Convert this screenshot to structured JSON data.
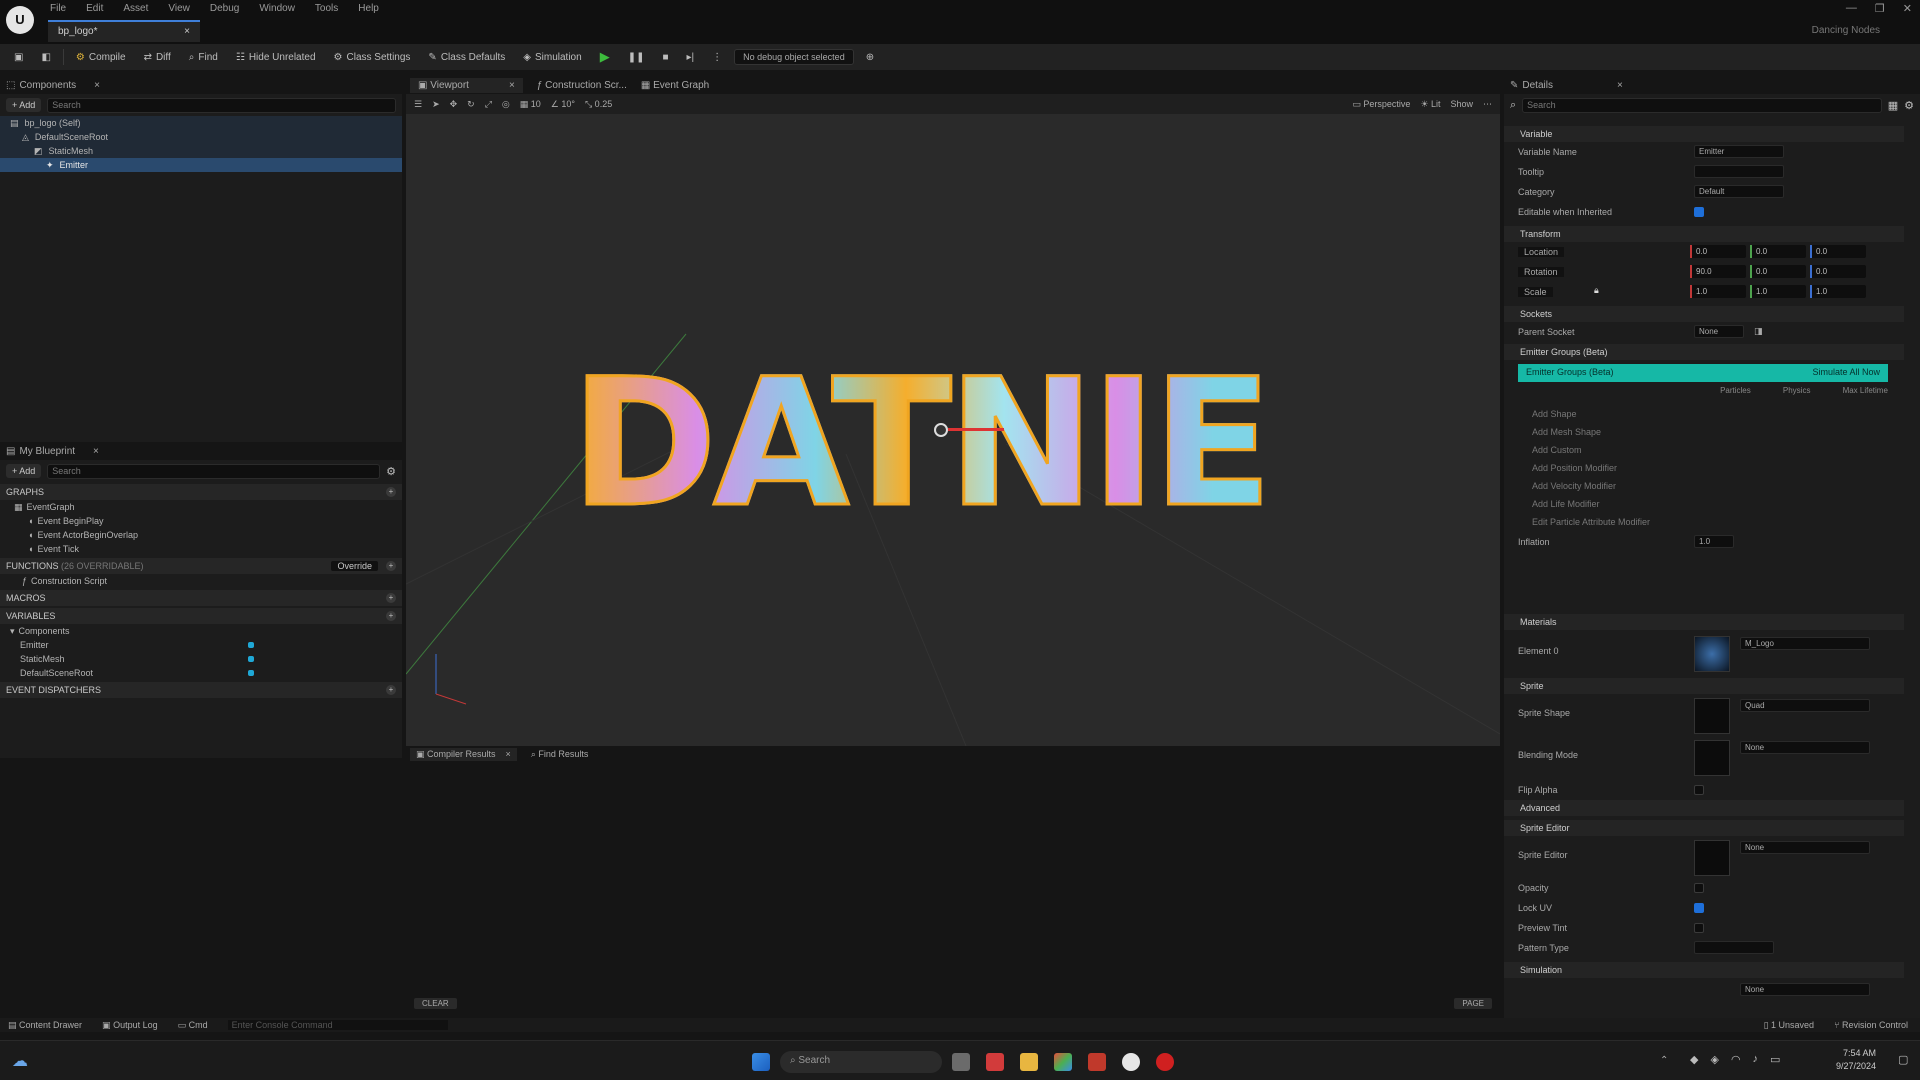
{
  "window": {
    "logo_glyph": "U",
    "menu": [
      "File",
      "Edit",
      "Asset",
      "View",
      "Debug",
      "Window",
      "Tools",
      "Help"
    ],
    "doc_tab": "bp_logo*",
    "doc_tab_close": "×",
    "project_name": "Dancing Nodes",
    "controls": [
      "—",
      "❐",
      "✕"
    ]
  },
  "toolbar": {
    "compile": "Compile",
    "diff": "Diff",
    "find": "Find",
    "hide_unrelated": "Hide Unrelated",
    "class_settings": "Class Settings",
    "class_defaults": "Class Defaults",
    "simulation": "Simulation",
    "debug_filter": "No debug object selected"
  },
  "components": {
    "tab": "Components",
    "add": "+ Add",
    "search_placeholder": "Search",
    "tree": [
      "bp_logo (Self)",
      "DefaultSceneRoot",
      "StaticMesh",
      "Emitter"
    ]
  },
  "my_blueprint": {
    "tab": "My Blueprint",
    "add": "+ Add",
    "search_placeholder": "Search",
    "graphs_label": "GRAPHS",
    "event_graph": "EventGraph",
    "events": [
      "Event BeginPlay",
      "Event ActorBeginOverlap",
      "Event Tick"
    ],
    "functions_label": "FUNCTIONS",
    "functions_hint": "(26 OVERRIDABLE)",
    "override_btn": "Override",
    "construction_script": "Construction Script",
    "macros_label": "MACROS",
    "variables_label": "VARIABLES",
    "components_label": "Components",
    "variables": [
      "Emitter",
      "StaticMesh",
      "DefaultSceneRoot"
    ],
    "dispatchers_label": "EVENT DISPATCHERS"
  },
  "viewport": {
    "tabs": [
      "Viewport",
      "Construction Scr...",
      "Event Graph"
    ],
    "perspective": "Perspective",
    "lit": "Lit",
    "show": "Show",
    "logo_text": "DATNIE"
  },
  "bottom": {
    "tabs": [
      "Compiler Results",
      "Find Results"
    ],
    "clear": "CLEAR",
    "page_btn": "PAGE"
  },
  "statusbar": {
    "content_drawer": "Content Drawer",
    "output_log": "Output Log",
    "cmd": "Cmd",
    "cmd_placeholder": "Enter Console Command",
    "unsaved": "1 Unsaved",
    "revision": "Revision Control"
  },
  "details": {
    "tab": "Details",
    "search_placeholder": "Search",
    "sections": {
      "variable": "Variable",
      "transform": "Transform",
      "sockets": "Sockets",
      "emitter_groups": "Emitter Groups (Beta)",
      "materials": "Materials",
      "sprite": "Sprite",
      "advanced": "Advanced",
      "sprite_editor": "Sprite Editor",
      "simulation": "Simulation"
    },
    "variable_rows": [
      {
        "label": "Variable Name",
        "value": "Emitter"
      },
      {
        "label": "Tooltip",
        "value": ""
      },
      {
        "label": "Category",
        "value": "Default"
      },
      {
        "label": "Editable when Inherited",
        "value": ""
      }
    ],
    "transform": {
      "location_label": "Location",
      "rotation_label": "Rotation",
      "scale_label": "Scale",
      "location": [
        "0.0",
        "0.0",
        "0.0"
      ],
      "rotation": [
        "90.0",
        "0.0",
        "0.0"
      ],
      "scale": [
        "1.0",
        "1.0",
        "1.0"
      ]
    },
    "sockets": {
      "label": "Parent Socket",
      "value": "None"
    },
    "emitter_groups": {
      "bar_label": "Emitter Groups (Beta)",
      "bar_action": "Simulate All Now",
      "columns": [
        "Particles",
        "Physics",
        "Max Lifetime"
      ],
      "rows": [
        "Add Shape",
        "Add Mesh Shape",
        "Add Custom",
        "Add Position Modifier",
        "Add Velocity Modifier",
        "Add Life Modifier",
        "Edit Particle Attribute Modifier"
      ],
      "inflation_label": "Inflation",
      "inflation": "1.0"
    },
    "materials": {
      "label": "Element 0",
      "value": "M_Logo"
    },
    "sprite": [
      {
        "label": "Sprite Shape",
        "value": "Quad"
      },
      {
        "label": "Blending Mode",
        "value": "None"
      },
      {
        "label": "Flip Alpha",
        "value": ""
      }
    ],
    "sprite_editor": [
      {
        "label": "Sprite Editor",
        "value": "None"
      },
      {
        "label": "Opacity",
        "value": ""
      },
      {
        "label": "Lock UV",
        "value": ""
      },
      {
        "label": "Preview Tint",
        "value": ""
      },
      {
        "label": "Pattern Type",
        "value": ""
      }
    ],
    "simulation": {
      "value": "None"
    }
  },
  "taskbar": {
    "search_placeholder": "Search",
    "time": "7:54 AM",
    "date": "9/27/2024"
  }
}
